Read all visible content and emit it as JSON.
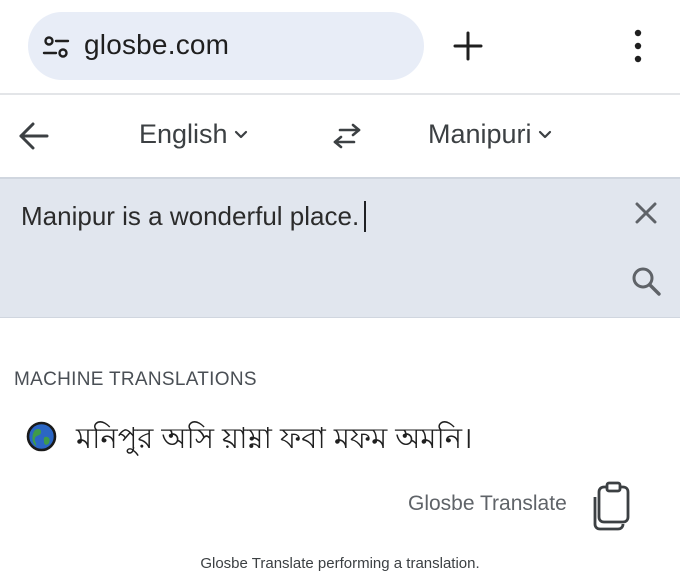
{
  "browser": {
    "url": "glosbe.com",
    "icons": {
      "site_settings": "tune-icon",
      "new_tab": "plus-icon",
      "menu": "more-vert-icon"
    }
  },
  "language_bar": {
    "source_language": "English",
    "target_language": "Manipuri",
    "icons": {
      "back": "arrow-left-icon",
      "swap": "swap-horiz-icon",
      "dropdown": "chevron-down-icon"
    }
  },
  "input": {
    "text": "Manipur is a wonderful place.",
    "icons": {
      "clear": "close-icon",
      "search": "search-icon"
    }
  },
  "results": {
    "section_title": "MACHINE TRANSLATIONS",
    "translation": "মনিপুর অসি য়াম্না ফবা মফম অমনি।",
    "provider": "Glosbe Translate",
    "footer": "Glosbe Translate performing a translation.",
    "icons": {
      "provider": "globe-icon",
      "copy": "copy-icon"
    }
  },
  "colors": {
    "url_pill_bg": "#e8edf7",
    "input_bg": "#e1e6ee",
    "text_primary": "#202124",
    "text_secondary": "#5f6368"
  }
}
